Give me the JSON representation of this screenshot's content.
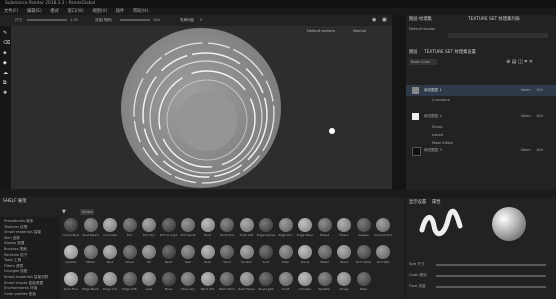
{
  "app": {
    "title": "Substance Painter 2018.3.3 - PaintsGlobal"
  },
  "menu": [
    "文件(F)",
    "编辑(E)",
    "模式",
    "窗口(W)",
    "视图(V)",
    "插件",
    "帮助(H)"
  ],
  "toolbar": {
    "size_label": "尺寸",
    "size_value": "1.92",
    "flow_label": "流量(笔刷)",
    "flow_value": "100",
    "stroke_label": "笔刷间距",
    "stroke_value": "5"
  },
  "viewport": {
    "view_mode": "Default camera",
    "channel": "Normal"
  },
  "right_panel": {
    "tabs": [
      "图层·纹理集",
      "TEXTURE SET 纹理集列表"
    ],
    "shader": "Default shader",
    "mode_tabs": [
      "图层",
      "TEXTURE SET 纹理集设置"
    ],
    "blend_field": "Base Color",
    "layers": [
      {
        "name": "填充图层 1",
        "blend": "Norm",
        "opacity": "100"
      },
      {
        "name": "Curvature",
        "blend": "",
        "opacity": ""
      },
      {
        "name": "填充图层 2",
        "blend": "Norm",
        "opacity": "100"
      },
      {
        "name": "Sharp",
        "blend": "",
        "opacity": ""
      },
      {
        "name": "Levels",
        "blend": "",
        "opacity": ""
      },
      {
        "name": "Mask Editor",
        "blend": "",
        "opacity": ""
      },
      {
        "name": "填充图层 3",
        "blend": "Norm",
        "opacity": "100"
      }
    ]
  },
  "shelf": {
    "title": "SHELF 展架",
    "filter_tag": "Smart",
    "categories": [
      "Procedurals 程序",
      "Textures 纹理",
      "Smart materials 智能",
      "Skin 皮肤",
      "Alphas 遮罩",
      "Brushes 笔刷",
      "Particles 粒子",
      "Tools 工具",
      "Filters 滤镜",
      "Grunges 肮脏",
      "Smart materials 智能材质",
      "Smart masks 智能遮罩",
      "Environments 环境",
      "Color profiles 配色"
    ],
    "items": [
      "Cloud Rust",
      "Rust Bleed",
      "Concrete",
      "Dirt",
      "Dirt Dry",
      "Dirt Grunge",
      "Dirt Spots",
      "Dust",
      "Dust Fine",
      "Dust Soft",
      "Edge Damage",
      "Edge Dirt",
      "Edge Wear",
      "Flakes",
      "Fibers",
      "Grease",
      "Ground Dirt",
      "Leather",
      "Metal",
      "Mud",
      "Noise",
      "Oil",
      "Paint",
      "Peel",
      "Rust",
      "Sand",
      "Scratch",
      "Soot",
      "Stain",
      "Stone",
      "Water",
      "Wood",
      "Dirt Damp",
      "Dirt Wet",
      "Rust Fine",
      "Edge Blunt",
      "Edge Cut",
      "Edge Soft",
      "Leak",
      "Moss",
      "Moss Dry",
      "Paint Old",
      "Paint Worn",
      "Rust Heavy",
      "Rust Light",
      "Scuff",
      "Smudge",
      "Splatter",
      "Stripe",
      "Wear"
    ]
  },
  "bottom_right": {
    "tabs": [
      "显示设置",
      "属性"
    ],
    "param1_label": "Size 尺寸",
    "param2_label": "Color 颜色",
    "param3_label": "Flow 流量"
  }
}
